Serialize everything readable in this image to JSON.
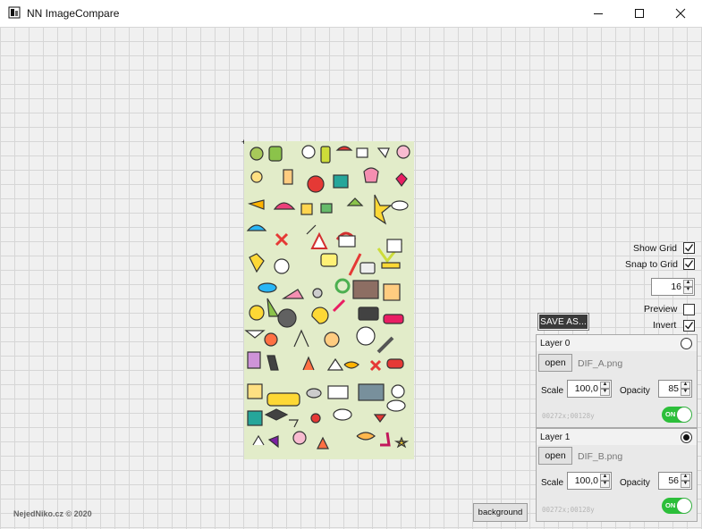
{
  "window": {
    "title": "NN ImageCompare"
  },
  "options": {
    "show_grid": {
      "label": "Show Grid",
      "checked": true
    },
    "snap_to_grid": {
      "label": "Snap to Grid",
      "checked": true
    },
    "grid_size": "16",
    "preview": {
      "label": "Preview",
      "checked": false
    },
    "invert": {
      "label": "Invert",
      "checked": true
    }
  },
  "save_as_label": "SAVE AS...",
  "layers": [
    {
      "title": "Layer 0",
      "selected": false,
      "open_label": "open",
      "filename": "DIF_A.png",
      "scale_label": "Scale",
      "scale_value": "100,0",
      "opacity_label": "Opacity",
      "opacity_value": "85",
      "dimensions": "00272x;00128y",
      "toggle_label": "ON"
    },
    {
      "title": "Layer 1",
      "selected": true,
      "open_label": "open",
      "filename": "DIF_B.png",
      "scale_label": "Scale",
      "scale_value": "100,0",
      "opacity_label": "Opacity",
      "opacity_value": "56",
      "dimensions": "00272x;00128y",
      "toggle_label": "ON"
    }
  ],
  "footer": {
    "credit": "NejedNiko.cz © 2020",
    "background_button": "background"
  },
  "colors": {
    "canvas_bg": "#f0f0f0",
    "grid_line": "#d6d6d6",
    "image_bg": "#e2ecc9",
    "toggle_on": "#2cbf3a",
    "save_button": "#3a3a3a"
  },
  "icons": [
    "app-icon",
    "minimize-icon",
    "maximize-icon",
    "close-icon",
    "checkmark-icon",
    "spinner-up-icon",
    "spinner-down-icon"
  ]
}
